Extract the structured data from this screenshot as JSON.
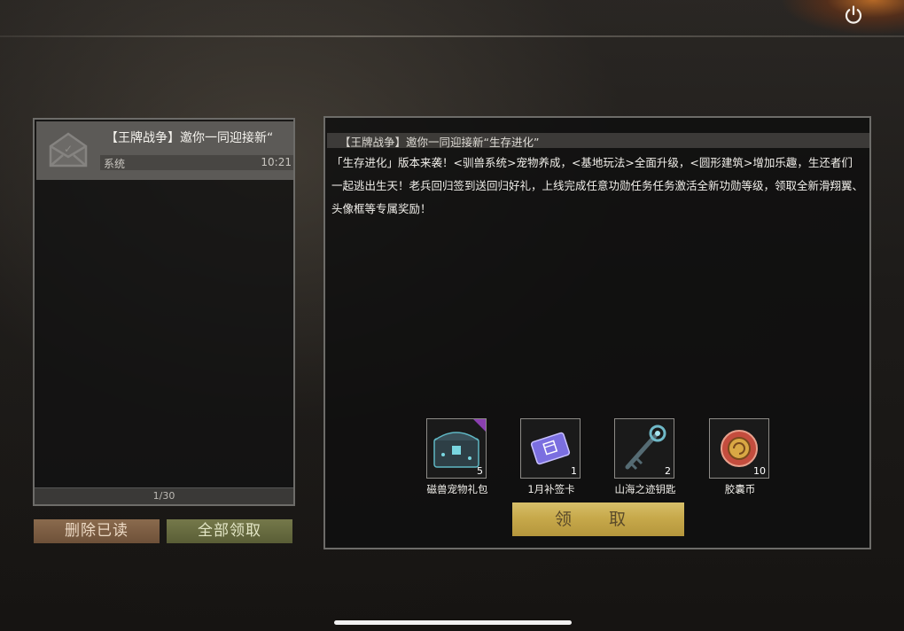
{
  "mail_list": {
    "items": [
      {
        "title": "【王牌战争】邀你一同迎接新“",
        "sender": "系统",
        "time": "10:21"
      }
    ],
    "page_indicator": "1/30"
  },
  "buttons": {
    "delete_read": "删除已读",
    "claim_all": "全部领取",
    "claim": "领 取"
  },
  "detail": {
    "title": "【王牌战争】邀你一同迎接新“生存进化”",
    "body": "「生存进化」版本来袭！<驯兽系统>宠物养成，<基地玩法>全面升级，<圆形建筑>增加乐趣，生还者们一起逃出生天！老兵回归签到送回归好礼，上线完成任意功勋任务任务激活全新功勋等级，领取全新滑翔翼、头像框等专属奖励！",
    "rewards": [
      {
        "name": "磁兽宠物礼包",
        "qty": "5",
        "icon": "chest-icon"
      },
      {
        "name": "1月补签卡",
        "qty": "1",
        "icon": "sign-card-icon"
      },
      {
        "name": "山海之迹钥匙",
        "qty": "2",
        "icon": "key-icon"
      },
      {
        "name": "胶囊币",
        "qty": "10",
        "icon": "coin-icon"
      }
    ]
  },
  "colors": {
    "delete_button": "#7d5e43",
    "claim_all_button": "#686b40",
    "claim_button": "#c9ab4d",
    "rare_corner": "#8a3fb0"
  }
}
